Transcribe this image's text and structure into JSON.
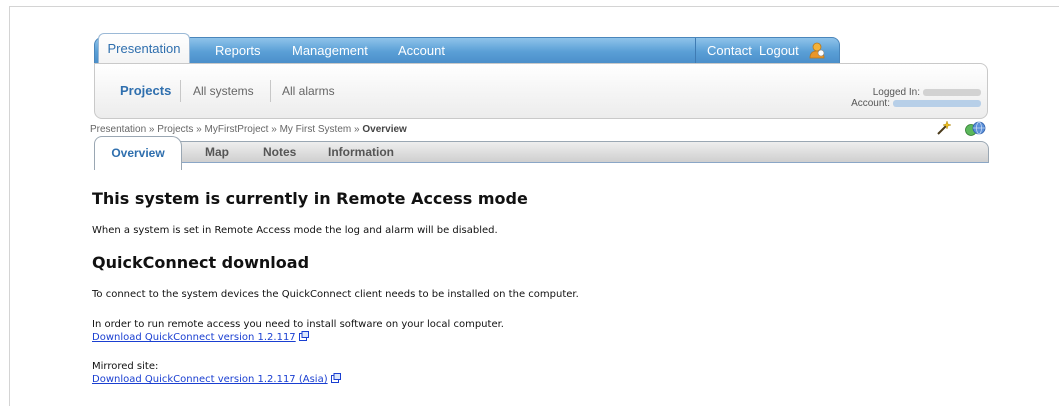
{
  "topnav": {
    "tabs": [
      {
        "label": "Presentation",
        "active": true
      },
      {
        "label": "Reports"
      },
      {
        "label": "Management"
      },
      {
        "label": "Account"
      }
    ],
    "contact": "Contact",
    "logout": "Logout"
  },
  "subnav": {
    "items": [
      {
        "label": "Projects",
        "active": true
      },
      {
        "label": "All systems"
      },
      {
        "label": "All alarms"
      }
    ],
    "logged_in_label": "Logged In:",
    "account_label": "Account:"
  },
  "breadcrumb": {
    "items": [
      "Presentation",
      "Projects",
      "MyFirstProject",
      "My First System"
    ],
    "separator": " » ",
    "current": "Overview"
  },
  "tabs": [
    {
      "label": "Overview",
      "active": true
    },
    {
      "label": "Map"
    },
    {
      "label": "Notes"
    },
    {
      "label": "Information"
    }
  ],
  "content": {
    "heading": "This system is currently in Remote Access mode",
    "remote_note": "When a system is set in Remote Access mode the log and alarm will be disabled.",
    "download_heading": "QuickConnect download",
    "connect_note": "To connect to the system devices the QuickConnect client needs to be installed on the computer.",
    "install_note": "In order to run remote access you need to install software on your local computer.",
    "download_link": "Download QuickConnect version 1.2.117",
    "mirror_label": "Mirrored site:",
    "mirror_link": "Download QuickConnect version 1.2.117 (Asia)"
  },
  "colors": {
    "nav_blue": "#5a9fd6",
    "active_tab_text": "#2f6fae",
    "link": "#1a3fd1"
  }
}
